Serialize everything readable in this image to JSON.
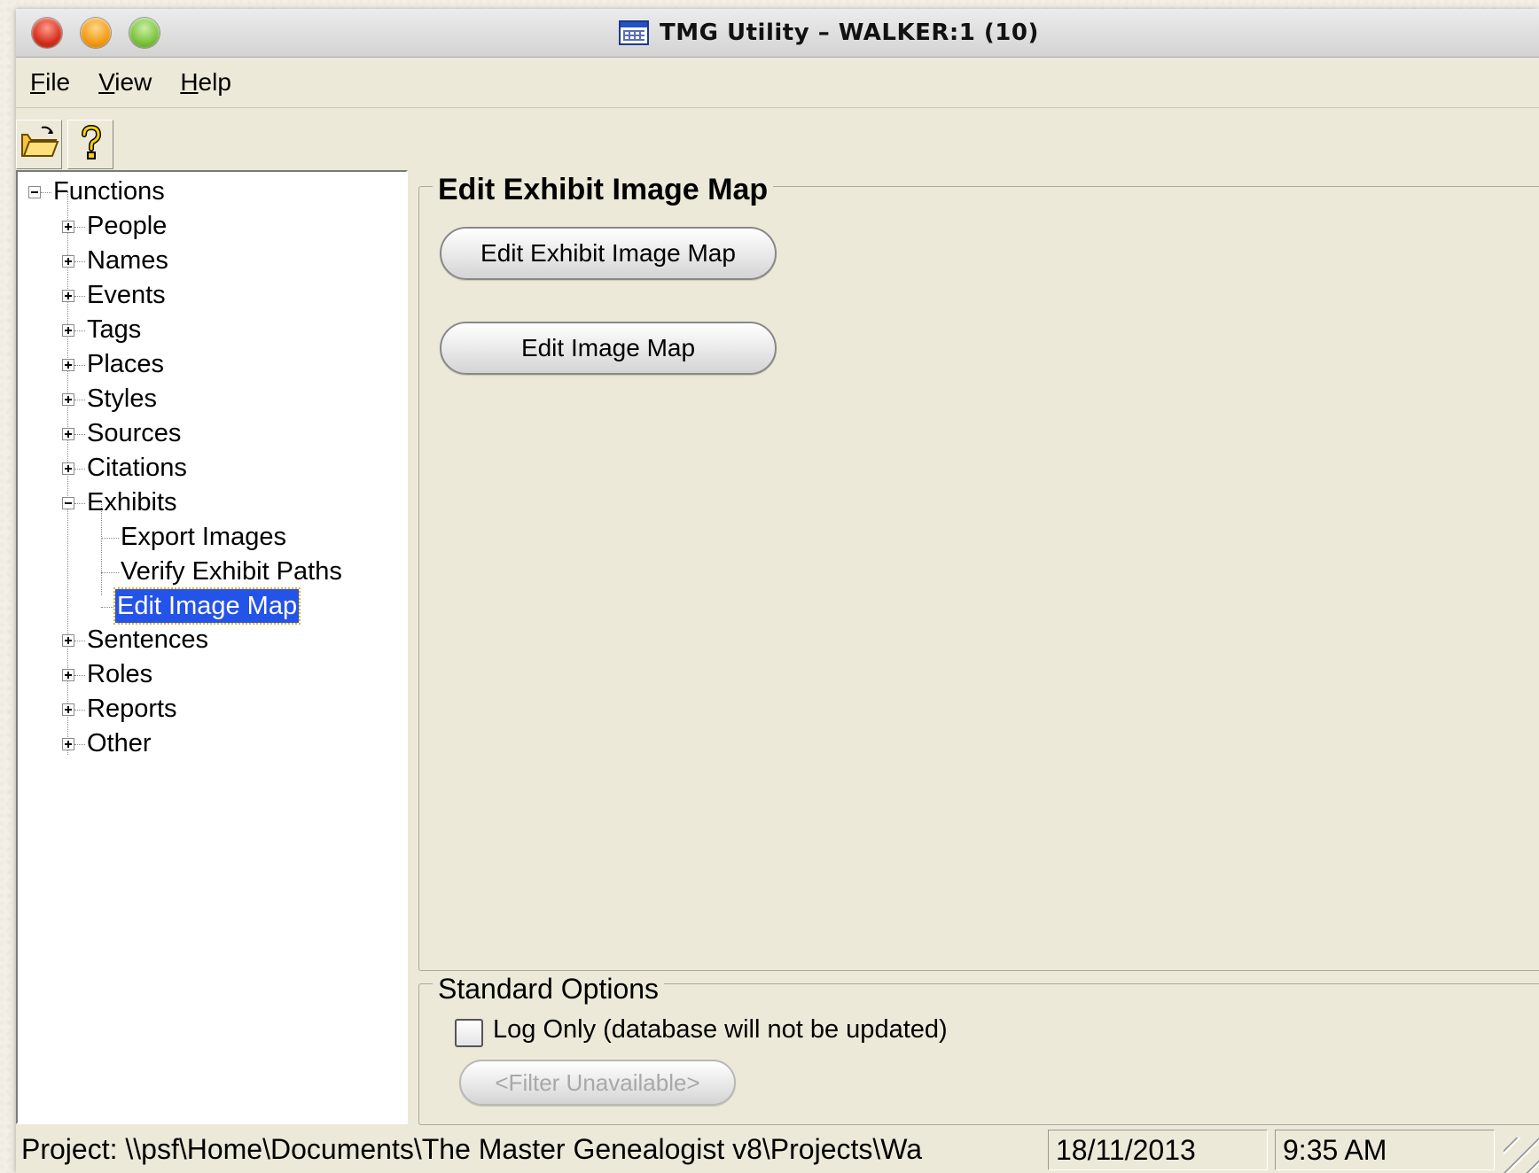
{
  "window": {
    "title": "TMG Utility – WALKER:1  (10)"
  },
  "menu": [
    {
      "accel": "F",
      "rest": "ile"
    },
    {
      "accel": "V",
      "rest": "iew"
    },
    {
      "accel": "H",
      "rest": "elp"
    }
  ],
  "toolbar": {
    "open_icon": "folder-open-icon",
    "help_icon": "question-mark-icon"
  },
  "tree": {
    "root": "Functions",
    "items": [
      {
        "label": "People"
      },
      {
        "label": "Names"
      },
      {
        "label": "Events"
      },
      {
        "label": "Tags"
      },
      {
        "label": "Places"
      },
      {
        "label": "Styles"
      },
      {
        "label": "Sources"
      },
      {
        "label": "Citations"
      },
      {
        "label": "Exhibits"
      },
      {
        "label": "Export Images"
      },
      {
        "label": "Verify Exhibit Paths"
      },
      {
        "label": "Edit Image Map"
      },
      {
        "label": "Sentences"
      },
      {
        "label": "Roles"
      },
      {
        "label": "Reports"
      },
      {
        "label": "Other"
      }
    ]
  },
  "main": {
    "group_title": "Edit Exhibit Image Map",
    "buttons": {
      "edit_exhibit_image_map": "Edit Exhibit Image Map",
      "edit_image_map": "Edit Image Map"
    }
  },
  "standard_options": {
    "title": "Standard Options",
    "log_only_label": "Log Only (database will not be updated)",
    "log_only_checked": false,
    "filter_button": "<Filter Unavailable>"
  },
  "status": {
    "project": "Project: \\\\psf\\Home\\Documents\\The Master Genealogist v8\\Projects\\Wa",
    "date": "18/11/2013",
    "time": "9:35 AM"
  },
  "colors": {
    "selection": "#2453e8",
    "window_bg": "#ece9d8"
  }
}
